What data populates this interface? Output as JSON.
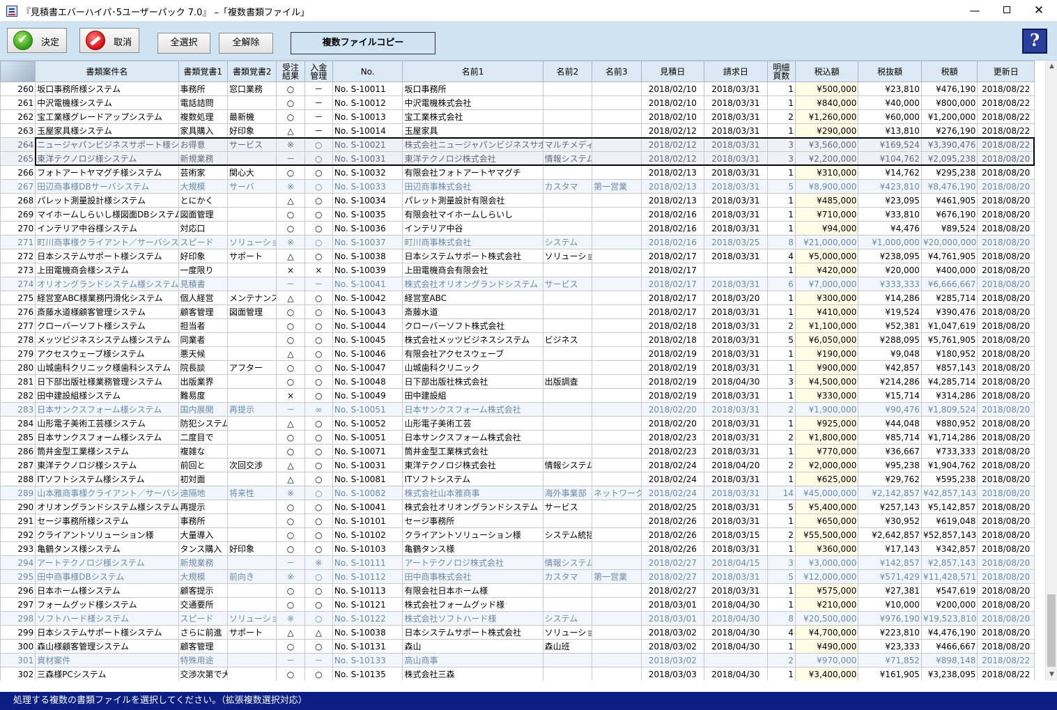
{
  "window": {
    "title": "『見積書エバーハイパ･5ユーザーパック 7.0』 –「複数書類ファイル」",
    "minimize": "—",
    "close": "✕"
  },
  "toolbar": {
    "ok_label": "決定",
    "cancel_label": "取消",
    "select_all": "全選択",
    "deselect_all": "全解除",
    "copy_label": "複数ファイルコピー",
    "help_label": "?"
  },
  "columns": {
    "name": "書類案件名",
    "memo1": "書類覚書1",
    "memo2": "書類覚書2",
    "order_result": "受注 結果",
    "payment": "入金 管理",
    "no": "No.",
    "name1": "名前1",
    "name2": "名前2",
    "name3": "名前3",
    "est_date": "見積日",
    "bill_date": "請求日",
    "pages": "明細 頁数",
    "incl_tax": "税込額",
    "excl_tax": "税抜額",
    "tax": "税額",
    "updated": "更新日"
  },
  "rows": [
    {
      "n": "260",
      "name": "坂口事務所様システム",
      "m1": "事務所",
      "m2": "窓口業務",
      "o": "○",
      "p": "－",
      "no": "No. S-10011",
      "n1": "坂口事務所",
      "n2": "",
      "n3": "",
      "ed": "2018/02/10",
      "bd": "2018/03/31",
      "pg": "1",
      "it": "¥500,000",
      "et": "¥23,810",
      "tx": "¥476,190",
      "up": "2018/08/22",
      "t": "n"
    },
    {
      "n": "261",
      "name": "中沢電機様システム",
      "m1": "電話詰問",
      "m2": "",
      "o": "○",
      "p": "－",
      "no": "No. S-10012",
      "n1": "中沢電機株式会社",
      "n2": "",
      "n3": "",
      "ed": "2018/02/10",
      "bd": "2018/03/31",
      "pg": "1",
      "it": "¥840,000",
      "et": "¥40,000",
      "tx": "¥800,000",
      "up": "2018/08/22",
      "t": "n"
    },
    {
      "n": "262",
      "name": "宝工業様グレードアップシステム",
      "m1": "複数処理",
      "m2": "最新機",
      "o": "○",
      "p": "－",
      "no": "No. S-10013",
      "n1": "宝工業株式会社",
      "n2": "",
      "n3": "",
      "ed": "2018/02/10",
      "bd": "2018/03/31",
      "pg": "2",
      "it": "¥1,260,000",
      "et": "¥60,000",
      "tx": "¥1,200,000",
      "up": "2018/08/22",
      "t": "n"
    },
    {
      "n": "263",
      "name": "玉屋家具様システム",
      "m1": "家具購入",
      "m2": "好印象",
      "o": "△",
      "p": "－",
      "no": "No. S-10014",
      "n1": "玉屋家具",
      "n2": "",
      "n3": "",
      "ed": "2018/02/12",
      "bd": "2018/03/31",
      "pg": "1",
      "it": "¥290,000",
      "et": "¥13,810",
      "tx": "¥276,190",
      "up": "2018/08/22",
      "t": "n"
    },
    {
      "n": "264",
      "name": "ニュージャパンビジネスサポート様システム",
      "m1": "お得意",
      "m2": "サービス",
      "o": "※",
      "p": "○",
      "no": "No. S-10021",
      "n1": "株式会社ニュージャパンビジネスサポート",
      "n2": "マルチメディア",
      "n3": "",
      "ed": "2018/02/12",
      "bd": "2018/03/31",
      "pg": "3",
      "it": "¥3,560,000",
      "et": "¥169,524",
      "tx": "¥3,390,476",
      "up": "2018/08/22",
      "t": "s"
    },
    {
      "n": "265",
      "name": "東洋テクノロジ様システム",
      "m1": "新規業務",
      "m2": "",
      "o": "－",
      "p": "○",
      "no": "No. S-10031",
      "n1": "東洋テクノロジ株式会社",
      "n2": "情報システム",
      "n3": "",
      "ed": "2018/02/12",
      "bd": "2018/03/31",
      "pg": "3",
      "it": "¥2,200,000",
      "et": "¥104,762",
      "tx": "¥2,095,238",
      "up": "2018/08/20",
      "t": "s"
    },
    {
      "n": "266",
      "name": "フォトアートヤマグチ様システム",
      "m1": "芸術家",
      "m2": "関心大",
      "o": "○",
      "p": "○",
      "no": "No. S-10032",
      "n1": "有限会社フォトアートヤマグチ",
      "n2": "",
      "n3": "",
      "ed": "2018/02/13",
      "bd": "2018/03/31",
      "pg": "1",
      "it": "¥310,000",
      "et": "¥14,762",
      "tx": "¥295,238",
      "up": "2018/08/20",
      "t": "n"
    },
    {
      "n": "267",
      "name": "田辺商事様DBサーバシステム",
      "m1": "大規模",
      "m2": "サーバ",
      "o": "※",
      "p": "○",
      "no": "No. S-10033",
      "n1": "田辺商事株式会社",
      "n2": "カスタマ",
      "n3": "第一営業",
      "ed": "2018/02/13",
      "bd": "2018/03/31",
      "pg": "5",
      "it": "¥8,900,000",
      "et": "¥423,810",
      "tx": "¥8,476,190",
      "up": "2018/08/20",
      "t": "b"
    },
    {
      "n": "268",
      "name": "パレット測量設計様システム",
      "m1": "とにかく",
      "m2": "",
      "o": "△",
      "p": "○",
      "no": "No. S-10034",
      "n1": "パレット測量設計有限会社",
      "n2": "",
      "n3": "",
      "ed": "2018/02/13",
      "bd": "2018/03/31",
      "pg": "1",
      "it": "¥485,000",
      "et": "¥23,095",
      "tx": "¥461,905",
      "up": "2018/08/20",
      "t": "n"
    },
    {
      "n": "269",
      "name": "マイホームしらいし様図面DBシステム",
      "m1": "図面管理",
      "m2": "",
      "o": "○",
      "p": "○",
      "no": "No. S-10035",
      "n1": "有限会社マイホームしらいし",
      "n2": "",
      "n3": "",
      "ed": "2018/02/16",
      "bd": "2018/03/31",
      "pg": "1",
      "it": "¥710,000",
      "et": "¥33,810",
      "tx": "¥676,190",
      "up": "2018/08/20",
      "t": "n"
    },
    {
      "n": "270",
      "name": "インテリア中谷様システム",
      "m1": "対応口",
      "m2": "",
      "o": "○",
      "p": "○",
      "no": "No. S-10036",
      "n1": "インテリア中谷",
      "n2": "",
      "n3": "",
      "ed": "2018/02/16",
      "bd": "2018/03/31",
      "pg": "1",
      "it": "¥94,000",
      "et": "¥4,476",
      "tx": "¥89,524",
      "up": "2018/08/20",
      "t": "n"
    },
    {
      "n": "271",
      "name": "町川商事様クライアント／サーバシステム",
      "m1": "スピード",
      "m2": "ソリューション",
      "o": "※",
      "p": "○",
      "no": "No. S-10037",
      "n1": "町川商事株式会社",
      "n2": "システム",
      "n3": "",
      "ed": "2018/02/16",
      "bd": "2018/03/25",
      "pg": "8",
      "it": "¥21,000,000",
      "et": "¥1,000,000",
      "tx": "¥20,000,000",
      "up": "2018/08/20",
      "t": "b"
    },
    {
      "n": "272",
      "name": "日本システムサポート様システム",
      "m1": "好印象",
      "m2": "サポート",
      "o": "△",
      "p": "○",
      "no": "No. S-10038",
      "n1": "日本システムサポート株式会社",
      "n2": "ソリューション本部",
      "n3": "",
      "ed": "2018/02/17",
      "bd": "2018/03/31",
      "pg": "4",
      "it": "¥5,000,000",
      "et": "¥238,095",
      "tx": "¥4,761,905",
      "up": "2018/08/20",
      "t": "n"
    },
    {
      "n": "273",
      "name": "上田電機商会様システム",
      "m1": "一度限り",
      "m2": "",
      "o": "×",
      "p": "×",
      "no": "No. S-10039",
      "n1": "上田電機商会有限会社",
      "n2": "",
      "n3": "",
      "ed": "2018/02/17",
      "bd": "",
      "pg": "1",
      "it": "¥420,000",
      "et": "¥20,000",
      "tx": "¥400,000",
      "up": "2018/08/20",
      "t": "n"
    },
    {
      "n": "274",
      "name": "オリオングランドシステム様システム",
      "m1": "見積書",
      "m2": "",
      "o": "－",
      "p": "－",
      "no": "No. S-10041",
      "n1": "株式会社オリオングランドシステム",
      "n2": "サービス",
      "n3": "",
      "ed": "2018/02/17",
      "bd": "2018/03/31",
      "pg": "6",
      "it": "¥7,000,000",
      "et": "¥333,333",
      "tx": "¥6,666,667",
      "up": "2018/08/20",
      "t": "b"
    },
    {
      "n": "275",
      "name": "経営室ABC様業務円滑化システム",
      "m1": "個人経営",
      "m2": "メンテナンス",
      "o": "△",
      "p": "○",
      "no": "No. S-10042",
      "n1": "経営室ABC",
      "n2": "",
      "n3": "",
      "ed": "2018/02/17",
      "bd": "2018/03/20",
      "pg": "1",
      "it": "¥300,000",
      "et": "¥14,286",
      "tx": "¥285,714",
      "up": "2018/08/20",
      "t": "n"
    },
    {
      "n": "276",
      "name": "斎藤水道様顧客管理システム",
      "m1": "顧客管理",
      "m2": "図面管理",
      "o": "○",
      "p": "○",
      "no": "No. S-10043",
      "n1": "斎藤水道",
      "n2": "",
      "n3": "",
      "ed": "2018/02/17",
      "bd": "2018/03/31",
      "pg": "1",
      "it": "¥410,000",
      "et": "¥19,524",
      "tx": "¥390,476",
      "up": "2018/08/20",
      "t": "n"
    },
    {
      "n": "277",
      "name": "クローバーソフト様システム",
      "m1": "担当者",
      "m2": "",
      "o": "○",
      "p": "○",
      "no": "No. S-10044",
      "n1": "クローバーソフト株式会社",
      "n2": "",
      "n3": "",
      "ed": "2018/02/18",
      "bd": "2018/03/31",
      "pg": "2",
      "it": "¥1,100,000",
      "et": "¥52,381",
      "tx": "¥1,047,619",
      "up": "2018/08/20",
      "t": "n"
    },
    {
      "n": "278",
      "name": "メッツビジネスシステム様システム",
      "m1": "同業者",
      "m2": "",
      "o": "○",
      "p": "○",
      "no": "No. S-10045",
      "n1": "株式会社メッツビジネスシステム",
      "n2": "ビジネス",
      "n3": "",
      "ed": "2018/02/18",
      "bd": "2018/03/31",
      "pg": "5",
      "it": "¥6,050,000",
      "et": "¥288,095",
      "tx": "¥5,761,905",
      "up": "2018/08/20",
      "t": "n"
    },
    {
      "n": "279",
      "name": "アクセスウェーブ様システム",
      "m1": "悪天候",
      "m2": "",
      "o": "△",
      "p": "○",
      "no": "No. S-10046",
      "n1": "有限会社アクセスウェーブ",
      "n2": "",
      "n3": "",
      "ed": "2018/02/19",
      "bd": "2018/03/31",
      "pg": "1",
      "it": "¥190,000",
      "et": "¥9,048",
      "tx": "¥180,952",
      "up": "2018/08/20",
      "t": "n"
    },
    {
      "n": "280",
      "name": "山城歯科クリニック様歯科システム",
      "m1": "院長談",
      "m2": "アフター",
      "o": "○",
      "p": "○",
      "no": "No. S-10047",
      "n1": "山城歯科クリニック",
      "n2": "",
      "n3": "",
      "ed": "2018/02/19",
      "bd": "2018/03/31",
      "pg": "1",
      "it": "¥900,000",
      "et": "¥42,857",
      "tx": "¥857,143",
      "up": "2018/08/20",
      "t": "n"
    },
    {
      "n": "281",
      "name": "日下部出版社様業務管理システム",
      "m1": "出版業界",
      "m2": "",
      "o": "○",
      "p": "○",
      "no": "No. S-10048",
      "n1": "日下部出版社株式会社",
      "n2": "出版調査",
      "n3": "",
      "ed": "2018/02/19",
      "bd": "2018/04/30",
      "pg": "3",
      "it": "¥4,500,000",
      "et": "¥214,286",
      "tx": "¥4,285,714",
      "up": "2018/08/20",
      "t": "n"
    },
    {
      "n": "282",
      "name": "田中建設組様システム",
      "m1": "難易度",
      "m2": "",
      "o": "×",
      "p": "○",
      "no": "No. S-10049",
      "n1": "田中建設組",
      "n2": "",
      "n3": "",
      "ed": "2018/02/19",
      "bd": "2018/03/31",
      "pg": "1",
      "it": "¥330,000",
      "et": "¥15,714",
      "tx": "¥314,286",
      "up": "2018/08/20",
      "t": "n"
    },
    {
      "n": "283",
      "name": "日本サンクスフォーム様システム",
      "m1": "国内展開",
      "m2": "再提示",
      "o": "－",
      "p": "∞",
      "no": "No. S-10051",
      "n1": "日本サンクスフォーム株式会社",
      "n2": "",
      "n3": "",
      "ed": "2018/02/20",
      "bd": "2018/03/31",
      "pg": "2",
      "it": "¥1,900,000",
      "et": "¥90,476",
      "tx": "¥1,809,524",
      "up": "2018/08/20",
      "t": "b"
    },
    {
      "n": "284",
      "name": "山形電子美術工芸様システム",
      "m1": "防犯システム",
      "m2": "",
      "o": "△",
      "p": "○",
      "no": "No. S-10052",
      "n1": "山形電子美術工芸",
      "n2": "",
      "n3": "",
      "ed": "2018/02/20",
      "bd": "2018/03/31",
      "pg": "1",
      "it": "¥925,000",
      "et": "¥44,048",
      "tx": "¥880,952",
      "up": "2018/08/20",
      "t": "n"
    },
    {
      "n": "285",
      "name": "日本サンクスフォーム様システム",
      "m1": "二度目で",
      "m2": "",
      "o": "○",
      "p": "○",
      "no": "No. S-10051",
      "n1": "日本サンクスフォーム株式会社",
      "n2": "",
      "n3": "",
      "ed": "2018/02/23",
      "bd": "2018/03/31",
      "pg": "2",
      "it": "¥1,800,000",
      "et": "¥85,714",
      "tx": "¥1,714,286",
      "up": "2018/08/20",
      "t": "n"
    },
    {
      "n": "286",
      "name": "筒井金型工業様システム",
      "m1": "複雑な",
      "m2": "",
      "o": "○",
      "p": "○",
      "no": "No. S-10071",
      "n1": "筒井金型工業株式会社",
      "n2": "",
      "n3": "",
      "ed": "2018/02/23",
      "bd": "2018/03/31",
      "pg": "1",
      "it": "¥770,000",
      "et": "¥36,667",
      "tx": "¥733,333",
      "up": "2018/08/20",
      "t": "n"
    },
    {
      "n": "287",
      "name": "東洋テクノロジ様システム",
      "m1": "前回と",
      "m2": "次回交渉",
      "o": "△",
      "p": "○",
      "no": "No. S-10031",
      "n1": "東洋テクノロジ株式会社",
      "n2": "情報システム",
      "n3": "",
      "ed": "2018/02/24",
      "bd": "2018/04/20",
      "pg": "2",
      "it": "¥2,000,000",
      "et": "¥95,238",
      "tx": "¥1,904,762",
      "up": "2018/08/20",
      "t": "n"
    },
    {
      "n": "288",
      "name": "ITソフトシステム様システム",
      "m1": "初対面",
      "m2": "",
      "o": "△",
      "p": "○",
      "no": "No. S-10081",
      "n1": "ITソフトシステム",
      "n2": "",
      "n3": "",
      "ed": "2018/02/24",
      "bd": "2018/03/31",
      "pg": "1",
      "it": "¥625,000",
      "et": "¥29,762",
      "tx": "¥595,238",
      "up": "2018/08/20",
      "t": "n"
    },
    {
      "n": "289",
      "name": "山本雅商事様クライアント／サーバシステム",
      "m1": "遠隔地",
      "m2": "将来性",
      "o": "※",
      "p": "○",
      "no": "No. S-10082",
      "n1": "株式会社山本雅商事",
      "n2": "海外事業部",
      "n3": "ネットワーク",
      "ed": "2018/02/24",
      "bd": "2018/03/31",
      "pg": "14",
      "it": "¥45,000,000",
      "et": "¥2,142,857",
      "tx": "¥42,857,143",
      "up": "2018/08/20",
      "t": "b"
    },
    {
      "n": "290",
      "name": "オリオングランドシステム様システム",
      "m1": "再提示",
      "m2": "",
      "o": "○",
      "p": "○",
      "no": "No. S-10041",
      "n1": "株式会社オリオングランドシステム",
      "n2": "サービス",
      "n3": "",
      "ed": "2018/02/25",
      "bd": "2018/03/31",
      "pg": "5",
      "it": "¥5,400,000",
      "et": "¥257,143",
      "tx": "¥5,142,857",
      "up": "2018/08/20",
      "t": "n"
    },
    {
      "n": "291",
      "name": "セージ事務所様システム",
      "m1": "事務所",
      "m2": "",
      "o": "○",
      "p": "○",
      "no": "No. S-10101",
      "n1": "セージ事務所",
      "n2": "",
      "n3": "",
      "ed": "2018/02/26",
      "bd": "2018/03/31",
      "pg": "1",
      "it": "¥650,000",
      "et": "¥30,952",
      "tx": "¥619,048",
      "up": "2018/08/20",
      "t": "n"
    },
    {
      "n": "292",
      "name": "クライアントソリューション様",
      "m1": "大量導入",
      "m2": "",
      "o": "○",
      "p": "○",
      "no": "No. S-10102",
      "n1": "クライアントソリューション様",
      "n2": "システム統括",
      "n3": "",
      "ed": "2018/02/26",
      "bd": "2018/03/15",
      "pg": "2",
      "it": "¥55,500,000",
      "et": "¥2,642,857",
      "tx": "¥52,857,143",
      "up": "2018/08/20",
      "t": "n"
    },
    {
      "n": "293",
      "name": "亀鶴タンス様システム",
      "m1": "タンス購入",
      "m2": "好印象",
      "o": "○",
      "p": "○",
      "no": "No. S-10103",
      "n1": "亀鶴タンス様",
      "n2": "",
      "n3": "",
      "ed": "2018/02/26",
      "bd": "2018/03/31",
      "pg": "1",
      "it": "¥360,000",
      "et": "¥17,143",
      "tx": "¥342,857",
      "up": "2018/08/20",
      "t": "n"
    },
    {
      "n": "294",
      "name": "アートテクノロジ様システム",
      "m1": "新規業務",
      "m2": "",
      "o": "－",
      "p": "※",
      "no": "No. S-10111",
      "n1": "アートテクノロジ株式会社",
      "n2": "情報システム",
      "n3": "",
      "ed": "2018/02/27",
      "bd": "2018/04/15",
      "pg": "3",
      "it": "¥3,000,000",
      "et": "¥142,857",
      "tx": "¥2,857,143",
      "up": "2018/08/20",
      "t": "b"
    },
    {
      "n": "295",
      "name": "田中商事様DBシステム",
      "m1": "大規模",
      "m2": "前向き",
      "o": "※",
      "p": "○",
      "no": "No. S-10112",
      "n1": "田中商事株式会社",
      "n2": "カスタマ",
      "n3": "第一営業",
      "ed": "2018/02/27",
      "bd": "2018/03/31",
      "pg": "5",
      "it": "¥12,000,000",
      "et": "¥571,429",
      "tx": "¥11,428,571",
      "up": "2018/08/20",
      "t": "b"
    },
    {
      "n": "296",
      "name": "日本ホーム様システム",
      "m1": "顧客提示",
      "m2": "",
      "o": "○",
      "p": "○",
      "no": "No. S-10113",
      "n1": "有限会社日本ホーム様",
      "n2": "",
      "n3": "",
      "ed": "2018/02/27",
      "bd": "2018/03/31",
      "pg": "1",
      "it": "¥575,000",
      "et": "¥27,381",
      "tx": "¥547,619",
      "up": "2018/08/20",
      "t": "n"
    },
    {
      "n": "297",
      "name": "フォームグッド様システム",
      "m1": "交通要所",
      "m2": "",
      "o": "○",
      "p": "○",
      "no": "No. S-10121",
      "n1": "株式会社フォームグッド様",
      "n2": "",
      "n3": "",
      "ed": "2018/03/01",
      "bd": "2018/04/30",
      "pg": "1",
      "it": "¥210,000",
      "et": "¥10,000",
      "tx": "¥200,000",
      "up": "2018/08/20",
      "t": "n"
    },
    {
      "n": "298",
      "name": "ソフトハード様システム",
      "m1": "スピード",
      "m2": "ソリューション",
      "o": "※",
      "p": "○",
      "no": "No. S-10122",
      "n1": "株式会社ソフトハード様",
      "n2": "システム",
      "n3": "",
      "ed": "2018/03/01",
      "bd": "2018/04/30",
      "pg": "8",
      "it": "¥20,500,000",
      "et": "¥976,190",
      "tx": "¥19,523,810",
      "up": "2018/08/20",
      "t": "b"
    },
    {
      "n": "299",
      "name": "日本システムサポート様システム",
      "m1": "さらに前進",
      "m2": "サポート",
      "o": "△",
      "p": "△",
      "no": "No. S-10038",
      "n1": "日本システムサポート株式会社",
      "n2": "ソリューション本部",
      "n3": "",
      "ed": "2018/03/02",
      "bd": "2018/04/30",
      "pg": "4",
      "it": "¥4,700,000",
      "et": "¥223,810",
      "tx": "¥4,476,190",
      "up": "2018/08/20",
      "t": "n"
    },
    {
      "n": "300",
      "name": "森山様顧客管理システム",
      "m1": "顧客管理",
      "m2": "",
      "o": "○",
      "p": "○",
      "no": "No. S-10131",
      "n1": "森山",
      "n2": "森山班",
      "n3": "",
      "ed": "2018/03/02",
      "bd": "2018/04/30",
      "pg": "1",
      "it": "¥490,000",
      "et": "¥23,333",
      "tx": "¥466,667",
      "up": "2018/08/20",
      "t": "n"
    },
    {
      "n": "301",
      "name": "資材案件",
      "m1": "特殊用途",
      "m2": "",
      "o": "－",
      "p": "－",
      "no": "No. S-10133",
      "n1": "高山商事",
      "n2": "",
      "n3": "",
      "ed": "2018/03/02",
      "bd": "",
      "pg": "2",
      "it": "¥970,000",
      "et": "¥71,852",
      "tx": "¥898,148",
      "up": "2018/08/22",
      "t": "b"
    },
    {
      "n": "302",
      "name": "三森様PCシステム",
      "m1": "交渉次第で大",
      "m2": "",
      "o": "○",
      "p": "○",
      "no": "No. S-10135",
      "n1": "株式会社三森",
      "n2": "",
      "n3": "",
      "ed": "2018/03/03",
      "bd": "2018/04/30",
      "pg": "1",
      "it": "¥3,400,000",
      "et": "¥161,905",
      "tx": "¥3,238,095",
      "up": "2018/08/22",
      "t": "n"
    }
  ],
  "status": {
    "message": "処理する複数の書類ファイルを選択してください。（拡張複数選択対応）"
  }
}
